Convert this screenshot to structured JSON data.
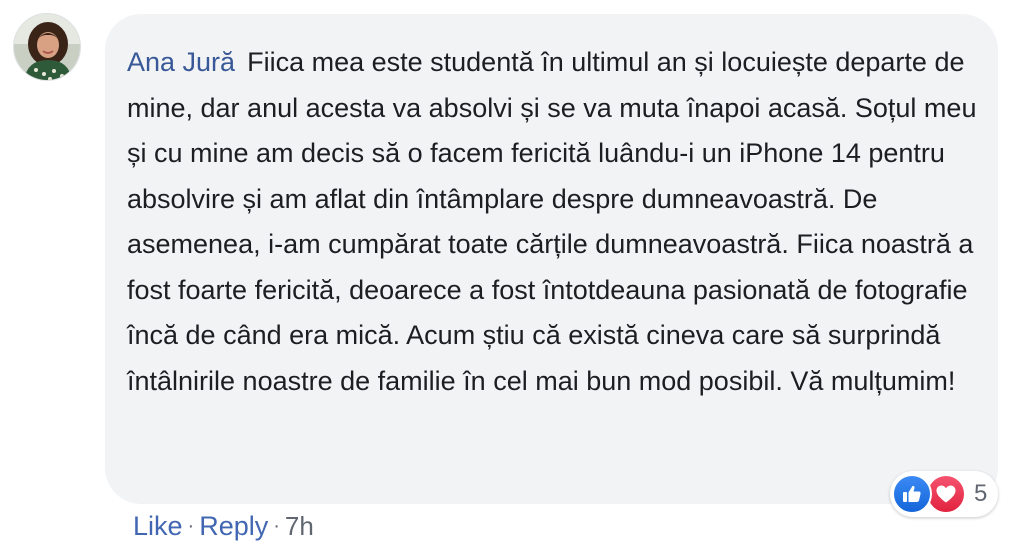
{
  "comment": {
    "author": "Ana Jură",
    "text": "Fiica mea este studentă în ultimul an și locuiește departe de mine, dar anul acesta va absolvi și se va muta înapoi acasă. Soțul meu și cu mine am decis să o facem fericită luându-i un iPhone 14 pentru absolvire și am aflat din întâmplare despre dumneavoastră. De asemenea, i-am cumpărat toate cărțile dumneavoastră. Fiica noastră a fost foarte fericită, deoarece a fost întotdeauna pasionată de fotografie încă de când era mică. Acum știu că există cineva care să surprindă întâlnirile noastre de familie în cel mai bun mod posibil. Vă mulțumim!",
    "avatar_icon": "profile-photo-woman",
    "reactions": {
      "icons": [
        "like-icon",
        "love-icon"
      ],
      "count": "5",
      "like_color": "#1877f2",
      "love_color": "#f33e58"
    },
    "actions": {
      "like": "Like",
      "separator": "·",
      "reply": "Reply",
      "time": "7h"
    }
  },
  "colors": {
    "bubble_bg": "#f2f3f5",
    "author": "#385898",
    "link": "#4267b2",
    "text": "#1c1e21",
    "meta": "#606770"
  }
}
